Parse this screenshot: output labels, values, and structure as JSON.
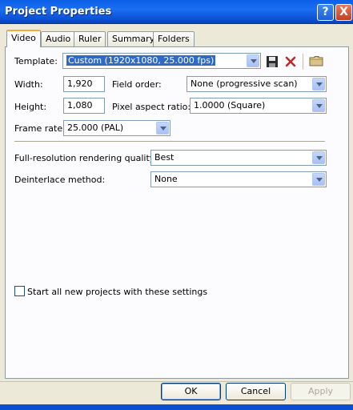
{
  "window": {
    "title": "Project Properties"
  },
  "tabs": [
    "Video",
    "Audio",
    "Ruler",
    "Summary",
    "Folders"
  ],
  "video": {
    "template_label": "Template:",
    "template_value": "Custom (1920x1080, 25.000 fps)",
    "width_label": "Width:",
    "width_value": "1,920",
    "height_label": "Height:",
    "height_value": "1,080",
    "field_order_label": "Field order:",
    "field_order_value": "None (progressive scan)",
    "pixel_aspect_label": "Pixel aspect ratio:",
    "pixel_aspect_value": "1.0000 (Square)",
    "frame_rate_label": "Frame rate:",
    "frame_rate_value": "25.000 (PAL)",
    "render_quality_label": "Full-resolution rendering quality:",
    "render_quality_value": "Best",
    "deinterlace_label": "Deinterlace method:",
    "deinterlace_value": "None",
    "start_all_label": "Start all new projects with these settings"
  },
  "buttons": {
    "ok": "OK",
    "cancel": "Cancel",
    "apply": "Apply"
  },
  "titlebar_buttons": {
    "help": "?",
    "close": "X"
  },
  "icons": [
    "save-icon",
    "delete-icon",
    "folder-icon"
  ]
}
